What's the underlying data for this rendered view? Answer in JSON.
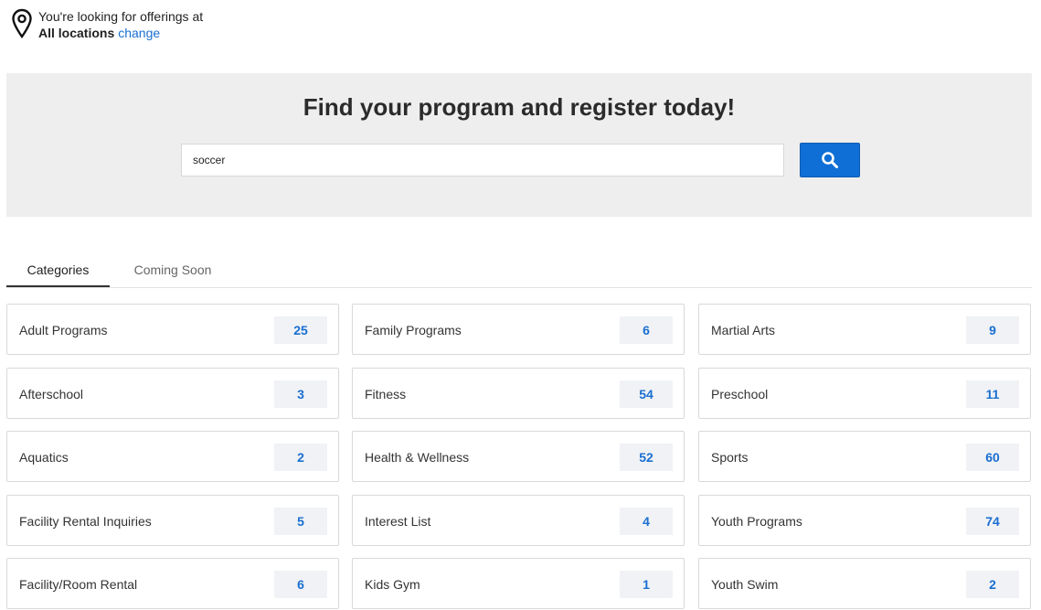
{
  "location": {
    "prompt": "You're looking for offerings at",
    "value": "All locations",
    "change_label": "change"
  },
  "hero": {
    "title": "Find your program and register today!",
    "search_value": "soccer"
  },
  "icons": {
    "location": "location-pin-icon",
    "search": "search-icon"
  },
  "colors": {
    "accent": "#1a6fd1",
    "button": "#0f6fd6",
    "hero_bg": "#eeeeee"
  },
  "tabs": [
    {
      "label": "Categories",
      "active": true
    },
    {
      "label": "Coming Soon",
      "active": false
    }
  ],
  "categories": [
    [
      {
        "label": "Adult Programs",
        "count": "25"
      },
      {
        "label": "Afterschool",
        "count": "3"
      },
      {
        "label": "Aquatics",
        "count": "2"
      },
      {
        "label": "Facility Rental Inquiries",
        "count": "5"
      },
      {
        "label": "Facility/Room Rental",
        "count": "6"
      }
    ],
    [
      {
        "label": "Family Programs",
        "count": "6"
      },
      {
        "label": "Fitness",
        "count": "54"
      },
      {
        "label": "Health & Wellness",
        "count": "52"
      },
      {
        "label": "Interest List",
        "count": "4"
      },
      {
        "label": "Kids Gym",
        "count": "1"
      }
    ],
    [
      {
        "label": "Martial Arts",
        "count": "9"
      },
      {
        "label": "Preschool",
        "count": "11"
      },
      {
        "label": "Sports",
        "count": "60"
      },
      {
        "label": "Youth Programs",
        "count": "74"
      },
      {
        "label": "Youth Swim",
        "count": "2"
      }
    ]
  ]
}
